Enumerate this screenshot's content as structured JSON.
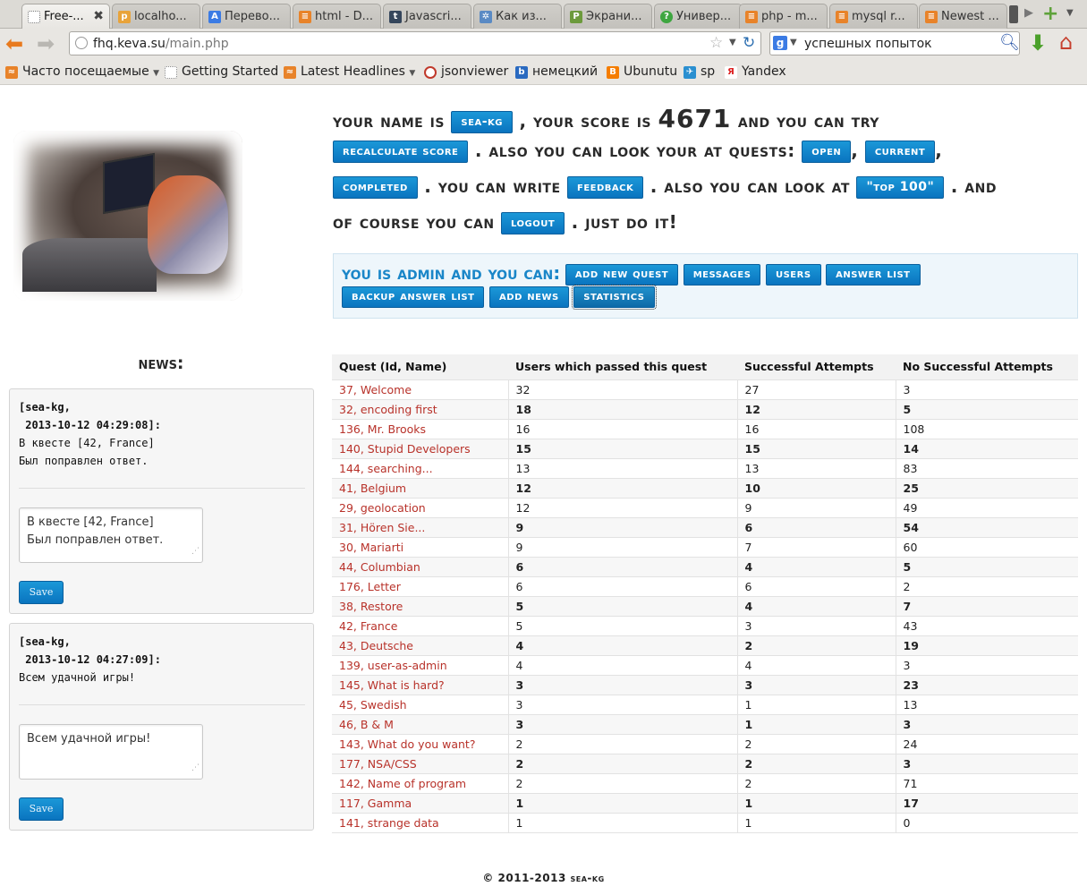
{
  "browser": {
    "tabs": [
      {
        "label": "Free-...",
        "icon": "blank-page-icon",
        "active": true
      },
      {
        "label": "localho...",
        "icon": "pma-icon"
      },
      {
        "label": "Перево...",
        "icon": "translate-icon"
      },
      {
        "label": "html - D...",
        "icon": "stackoverflow-icon"
      },
      {
        "label": "Javascri...",
        "icon": "tumblr-icon"
      },
      {
        "label": "Как из...",
        "icon": "puzzle-icon"
      },
      {
        "label": "Экрани...",
        "icon": "leaf-icon"
      },
      {
        "label": "Универ...",
        "icon": "help-icon"
      },
      {
        "label": "php - m...",
        "icon": "stackoverflow-icon"
      },
      {
        "label": "mysql r...",
        "icon": "stackoverflow-icon"
      },
      {
        "label": "Newest ...",
        "icon": "stackoverflow-icon"
      }
    ],
    "url_host": "fhq.keva.su",
    "url_path": "/main.php",
    "search_text": "успешных попыток",
    "bookmarks": [
      {
        "label": "Часто посещаемые",
        "icon": "rss-icon",
        "dropdown": true
      },
      {
        "label": "Getting Started",
        "icon": "page-icon"
      },
      {
        "label": "Latest Headlines",
        "icon": "rss-icon",
        "dropdown": true
      },
      {
        "label": "jsonviewer",
        "icon": "json-icon"
      },
      {
        "label": "немецкий",
        "icon": "letter-b-icon"
      },
      {
        "label": "Ubunutu",
        "icon": "blogger-icon"
      },
      {
        "label": "sp",
        "icon": "cart-icon"
      },
      {
        "label": "Yandex",
        "icon": "yandex-icon"
      }
    ]
  },
  "intro": {
    "t1": "Your name is",
    "username": "sea-kg",
    "t2": ", your score is",
    "score": "4671",
    "t3": "and you can try",
    "recalc": "recalculate score",
    "t4": ". Also you can look your at quests:",
    "open": "open",
    "current": "current",
    "completed": "completed",
    "t5": ". You can write",
    "feedback": "feedback",
    "t6": ". Also you can look at",
    "top100": "\"Top 100\"",
    "t7": ". And",
    "t8": "of course you can",
    "logout": "logout",
    "t9": ". Just do it!",
    "comma": ","
  },
  "admin": {
    "label": "You is admin and you can:",
    "buttons": [
      "Add new quest",
      "Messages",
      "Users",
      "Answer list",
      "Backup answer list",
      "Add news",
      "Statistics"
    ]
  },
  "news": {
    "title": "News:",
    "save_label": "Save",
    "items": [
      {
        "head": "[sea-kg,\n 2013-10-12 04:29:08]:",
        "body": "В квесте [42, France]\nБыл поправлен ответ.",
        "edit": "В квесте [42, France]\nБыл поправлен ответ."
      },
      {
        "head": "[sea-kg,\n 2013-10-12 04:27:09]:",
        "body": "Всем удачной игры!",
        "edit": "Всем удачной игры!"
      }
    ]
  },
  "stats": {
    "headers": [
      "Quest (Id, Name)",
      "Users which passed this quest",
      "Successful Attempts",
      "No Successful Attempts"
    ],
    "rows": [
      [
        "37, Welcome",
        "32",
        "27",
        "3"
      ],
      [
        "32, encoding first",
        "18",
        "12",
        "5"
      ],
      [
        "136, Mr. Brooks",
        "16",
        "16",
        "108"
      ],
      [
        "140, Stupid Developers",
        "15",
        "15",
        "14"
      ],
      [
        "144, searching...",
        "13",
        "13",
        "83"
      ],
      [
        "41, Belgium",
        "12",
        "10",
        "25"
      ],
      [
        "29, geolocation",
        "12",
        "9",
        "49"
      ],
      [
        "31, Hören Sie...",
        "9",
        "6",
        "54"
      ],
      [
        "30, Mariarti",
        "9",
        "7",
        "60"
      ],
      [
        "44, Columbian",
        "6",
        "4",
        "5"
      ],
      [
        "176, Letter",
        "6",
        "6",
        "2"
      ],
      [
        "38, Restore",
        "5",
        "4",
        "7"
      ],
      [
        "42, France",
        "5",
        "3",
        "43"
      ],
      [
        "43, Deutsche",
        "4",
        "2",
        "19"
      ],
      [
        "139, user-as-admin",
        "4",
        "4",
        "3"
      ],
      [
        "145, What is hard?",
        "3",
        "3",
        "23"
      ],
      [
        "45, Swedish",
        "3",
        "1",
        "13"
      ],
      [
        "46, B & M",
        "3",
        "1",
        "3"
      ],
      [
        "143, What do you want?",
        "2",
        "2",
        "24"
      ],
      [
        "177, NSA/CSS",
        "2",
        "2",
        "3"
      ],
      [
        "142, Name of program",
        "2",
        "2",
        "71"
      ],
      [
        "117, Gamma",
        "1",
        "1",
        "17"
      ],
      [
        "141, strange data",
        "1",
        "1",
        "0"
      ]
    ]
  },
  "footer": "© 2011-2013 sea-kg"
}
